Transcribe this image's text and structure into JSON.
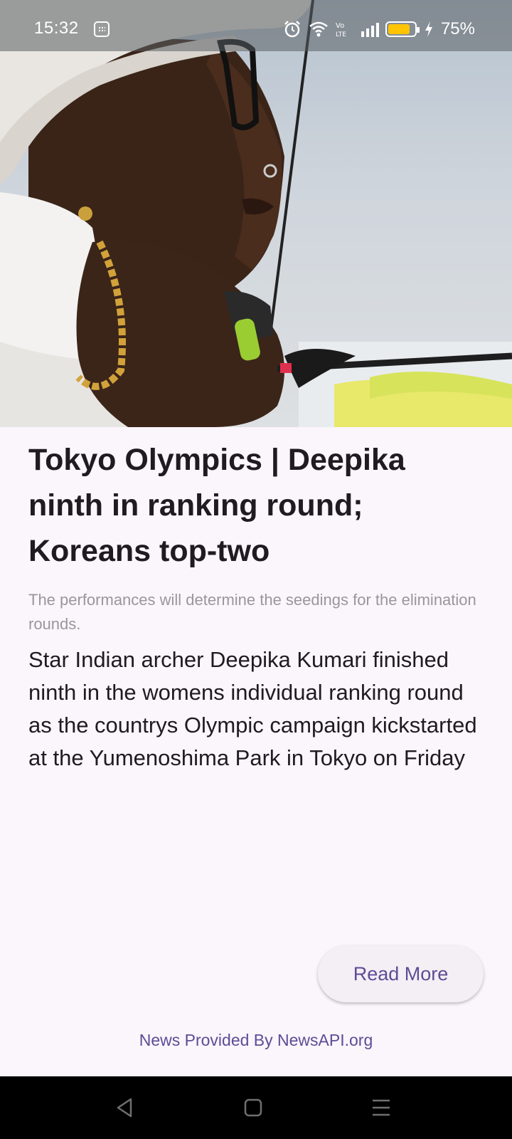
{
  "status_bar": {
    "time": "15:32",
    "battery_percent": "75%",
    "icons": [
      "app-grid-icon",
      "alarm-icon",
      "wifi-icon",
      "volte-icon",
      "signal-icon",
      "battery-icon",
      "charging-icon"
    ],
    "battery_level": 0.75,
    "battery_color": "#ffc400"
  },
  "article": {
    "title": "Tokyo Olympics | Deepika ninth in ranking round; Koreans top-two",
    "description": "The performances will determine the seedings for the elimination rounds.",
    "content": "Star Indian archer Deepika Kumari finished ninth in the womens individual ranking round as the countrys Olympic campaign kickstarted at the Yumenoshima Park in Tokyo on Friday"
  },
  "actions": {
    "read_more_label": "Read More"
  },
  "footer": {
    "provider_text": "News Provided By NewsAPI.org"
  },
  "colors": {
    "accent": "#5e4c95",
    "background": "#fbf5fc",
    "title": "#1f1b20",
    "subtitle": "#9a969c"
  },
  "navigation": {
    "buttons": [
      "back-icon",
      "home-icon",
      "menu-icon"
    ]
  }
}
